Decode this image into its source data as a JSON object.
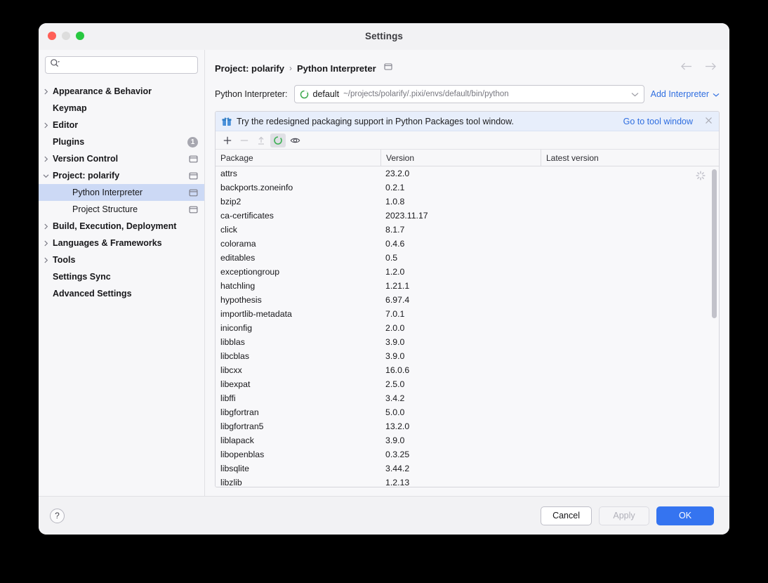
{
  "window": {
    "title": "Settings",
    "traffic_lights": [
      "close-red",
      "minimize-gray",
      "zoom-green"
    ]
  },
  "sidebar": {
    "search": {
      "value": "",
      "placeholder": "",
      "icon": "search-icon"
    },
    "items": [
      {
        "label": "Appearance & Behavior",
        "expandable": true,
        "expanded": false,
        "bold": true,
        "child": false,
        "selected": false,
        "badge": null,
        "proj_icon": false
      },
      {
        "label": "Keymap",
        "expandable": false,
        "expanded": false,
        "bold": true,
        "child": false,
        "selected": false,
        "badge": null,
        "proj_icon": false
      },
      {
        "label": "Editor",
        "expandable": true,
        "expanded": false,
        "bold": true,
        "child": false,
        "selected": false,
        "badge": null,
        "proj_icon": false
      },
      {
        "label": "Plugins",
        "expandable": false,
        "expanded": false,
        "bold": true,
        "child": false,
        "selected": false,
        "badge": "1",
        "proj_icon": false
      },
      {
        "label": "Version Control",
        "expandable": true,
        "expanded": false,
        "bold": true,
        "child": false,
        "selected": false,
        "badge": null,
        "proj_icon": true
      },
      {
        "label": "Project: polarify",
        "expandable": true,
        "expanded": true,
        "bold": true,
        "child": false,
        "selected": false,
        "badge": null,
        "proj_icon": true
      },
      {
        "label": "Python Interpreter",
        "expandable": false,
        "expanded": false,
        "bold": false,
        "child": true,
        "selected": true,
        "badge": null,
        "proj_icon": true
      },
      {
        "label": "Project Structure",
        "expandable": false,
        "expanded": false,
        "bold": false,
        "child": true,
        "selected": false,
        "badge": null,
        "proj_icon": true
      },
      {
        "label": "Build, Execution, Deployment",
        "expandable": true,
        "expanded": false,
        "bold": true,
        "child": false,
        "selected": false,
        "badge": null,
        "proj_icon": false
      },
      {
        "label": "Languages & Frameworks",
        "expandable": true,
        "expanded": false,
        "bold": true,
        "child": false,
        "selected": false,
        "badge": null,
        "proj_icon": false
      },
      {
        "label": "Tools",
        "expandable": true,
        "expanded": false,
        "bold": true,
        "child": false,
        "selected": false,
        "badge": null,
        "proj_icon": false
      },
      {
        "label": "Settings Sync",
        "expandable": false,
        "expanded": false,
        "bold": true,
        "child": false,
        "selected": false,
        "badge": null,
        "proj_icon": false
      },
      {
        "label": "Advanced Settings",
        "expandable": false,
        "expanded": false,
        "bold": true,
        "child": false,
        "selected": false,
        "badge": null,
        "proj_icon": false
      }
    ]
  },
  "content": {
    "breadcrumb": {
      "root": "Project: polarify",
      "separator": "›",
      "leaf": "Python Interpreter",
      "scope_icon": "project-scope-icon"
    },
    "nav": {
      "back_icon": "arrow-left-icon",
      "forward_icon": "arrow-right-icon"
    },
    "interpreter": {
      "label": "Python Interpreter:",
      "env_icon": "conda-env-icon",
      "name": "default",
      "path": "~/projects/polarify/.pixi/envs/default/bin/python",
      "caret_icon": "chevron-down-icon",
      "add_link": "Add Interpreter",
      "add_caret_icon": "chevron-down-icon"
    },
    "banner": {
      "icon": "gift-icon",
      "text": "Try the redesigned packaging support in Python Packages tool window.",
      "link": "Go to tool window",
      "close_icon": "close-icon"
    },
    "toolbar": [
      {
        "name": "add-package-button",
        "icon": "plus-icon",
        "state": "enabled"
      },
      {
        "name": "remove-package-button",
        "icon": "minus-icon",
        "state": "disabled"
      },
      {
        "name": "upgrade-package-button",
        "icon": "arrow-up-icon",
        "state": "disabled"
      },
      {
        "name": "refresh-packages-button",
        "icon": "loading-spinner-icon",
        "state": "active"
      },
      {
        "name": "show-early-releases-button",
        "icon": "eye-icon",
        "state": "enabled"
      }
    ],
    "packages_table": {
      "columns": [
        "Package",
        "Version",
        "Latest version"
      ],
      "loading_icon": "loading-spinner-icon",
      "rows": [
        {
          "package": "attrs",
          "version": "23.2.0",
          "latest": ""
        },
        {
          "package": "backports.zoneinfo",
          "version": "0.2.1",
          "latest": ""
        },
        {
          "package": "bzip2",
          "version": "1.0.8",
          "latest": ""
        },
        {
          "package": "ca-certificates",
          "version": "2023.11.17",
          "latest": ""
        },
        {
          "package": "click",
          "version": "8.1.7",
          "latest": ""
        },
        {
          "package": "colorama",
          "version": "0.4.6",
          "latest": ""
        },
        {
          "package": "editables",
          "version": "0.5",
          "latest": ""
        },
        {
          "package": "exceptiongroup",
          "version": "1.2.0",
          "latest": ""
        },
        {
          "package": "hatchling",
          "version": "1.21.1",
          "latest": ""
        },
        {
          "package": "hypothesis",
          "version": "6.97.4",
          "latest": ""
        },
        {
          "package": "importlib-metadata",
          "version": "7.0.1",
          "latest": ""
        },
        {
          "package": "iniconfig",
          "version": "2.0.0",
          "latest": ""
        },
        {
          "package": "libblas",
          "version": "3.9.0",
          "latest": ""
        },
        {
          "package": "libcblas",
          "version": "3.9.0",
          "latest": ""
        },
        {
          "package": "libcxx",
          "version": "16.0.6",
          "latest": ""
        },
        {
          "package": "libexpat",
          "version": "2.5.0",
          "latest": ""
        },
        {
          "package": "libffi",
          "version": "3.4.2",
          "latest": ""
        },
        {
          "package": "libgfortran",
          "version": "5.0.0",
          "latest": ""
        },
        {
          "package": "libgfortran5",
          "version": "13.2.0",
          "latest": ""
        },
        {
          "package": "liblapack",
          "version": "3.9.0",
          "latest": ""
        },
        {
          "package": "libopenblas",
          "version": "0.3.25",
          "latest": ""
        },
        {
          "package": "libsqlite",
          "version": "3.44.2",
          "latest": ""
        },
        {
          "package": "libzlib",
          "version": "1.2.13",
          "latest": ""
        }
      ]
    }
  },
  "footer": {
    "help_label": "?",
    "cancel_label": "Cancel",
    "apply_label": "Apply",
    "ok_label": "OK"
  },
  "colors": {
    "accent_blue": "#3574f0",
    "link_blue": "#2f6ee0",
    "selection_blue": "#ccd9f5",
    "banner_blue": "#e7eefb",
    "env_green": "#3ea94e"
  }
}
